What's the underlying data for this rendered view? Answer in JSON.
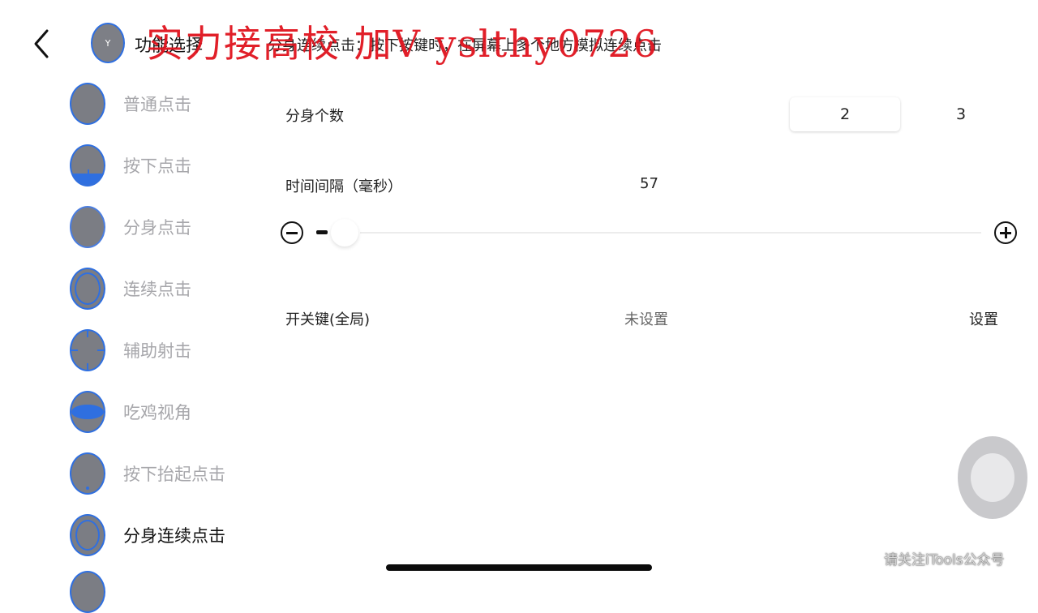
{
  "header": {
    "avatar_letter": "Y",
    "title": "功能选择",
    "description": "分身连续点击：按下按键时，在屏幕上多个地方模拟连续点击"
  },
  "watermark": "实力接高校 加V yslthy0726",
  "sidebar": {
    "items": [
      {
        "label": "普通点击",
        "icon": "circle-icon",
        "active": false
      },
      {
        "label": "按下点击",
        "icon": "press-down-icon",
        "active": false
      },
      {
        "label": "分身点击",
        "icon": "clone-tap-icon",
        "active": false
      },
      {
        "label": "连续点击",
        "icon": "double-ring-icon",
        "active": false
      },
      {
        "label": "辅助射击",
        "icon": "crosshair-icon",
        "active": false
      },
      {
        "label": "吃鸡视角",
        "icon": "eye-view-icon",
        "active": false
      },
      {
        "label": "按下抬起点击",
        "icon": "press-release-icon",
        "active": false
      },
      {
        "label": "分身连续点击",
        "icon": "clone-continuous-icon",
        "active": true
      }
    ]
  },
  "settings": {
    "clone_count_label": "分身个数",
    "clone_count_options": [
      "2",
      "3"
    ],
    "clone_count_selected": "2",
    "interval_label": "时间间隔（毫秒）",
    "interval_value": "57",
    "interval_fraction": 0.0,
    "hotkey_label": "开关键(全局)",
    "hotkey_value": "未设置",
    "hotkey_action": "设置"
  },
  "footer": {
    "note": "请关注iTools公众号"
  },
  "colors": {
    "accent": "#2f6fe0",
    "watermark": "#e0141e",
    "icon_fill": "#7b7d84"
  }
}
